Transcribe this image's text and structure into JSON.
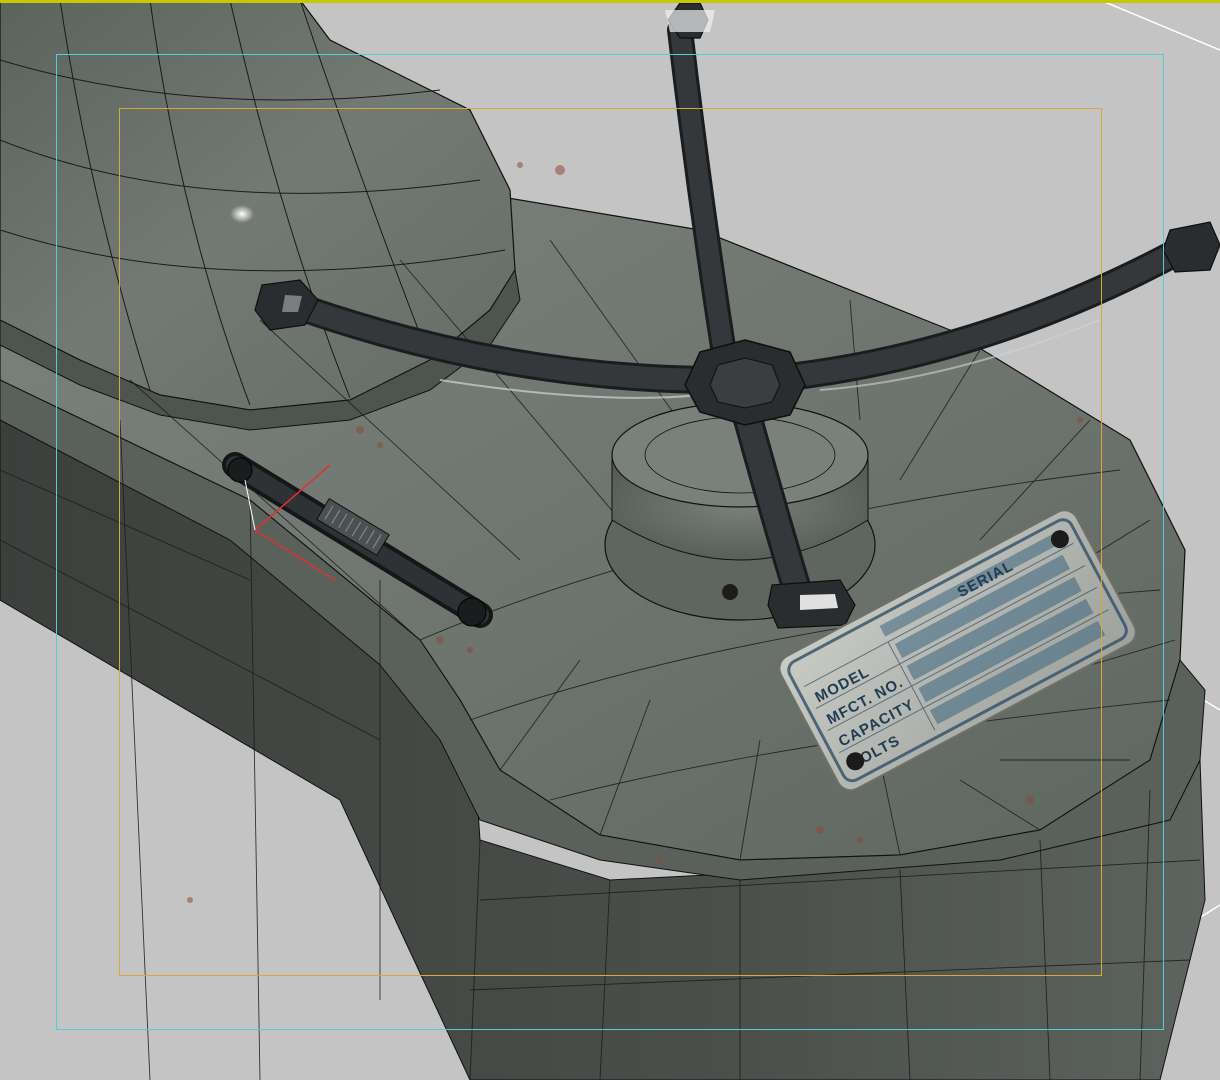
{
  "viewport": {
    "kind": "3D modeling perspective viewport",
    "view": "perspective",
    "shading": "textured + wireframe overlay"
  },
  "colors": {
    "background": "#c4c4c4",
    "top_border": "#c8c800",
    "safe_frame_outer": "#4fd0d8",
    "safe_frame_inner": "#d8a838",
    "model_base": "#6f7670",
    "model_dark_side": "#3a3d3a",
    "handwheel": "#2b2e30",
    "nameplate": "#b9bcb6",
    "nameplate_ink": "#1f3c52",
    "rust": "#8a4a3a",
    "gizmo": "#e03030"
  },
  "objects": [
    {
      "name": "machine-base",
      "type": "mesh"
    },
    {
      "name": "column-housing",
      "type": "mesh"
    },
    {
      "name": "handwheel-spokes",
      "type": "mesh"
    },
    {
      "name": "hub-boss",
      "type": "mesh"
    },
    {
      "name": "lock-lever",
      "type": "mesh"
    },
    {
      "name": "nameplate",
      "type": "textured decal"
    }
  ],
  "nameplate": {
    "labels": [
      "MODEL",
      "SERIAL",
      "MFCT. NO.",
      "CAPACITY",
      "VOLTS"
    ]
  },
  "icons": [
    "transform-gizmo-icon",
    "specular-highlight"
  ]
}
